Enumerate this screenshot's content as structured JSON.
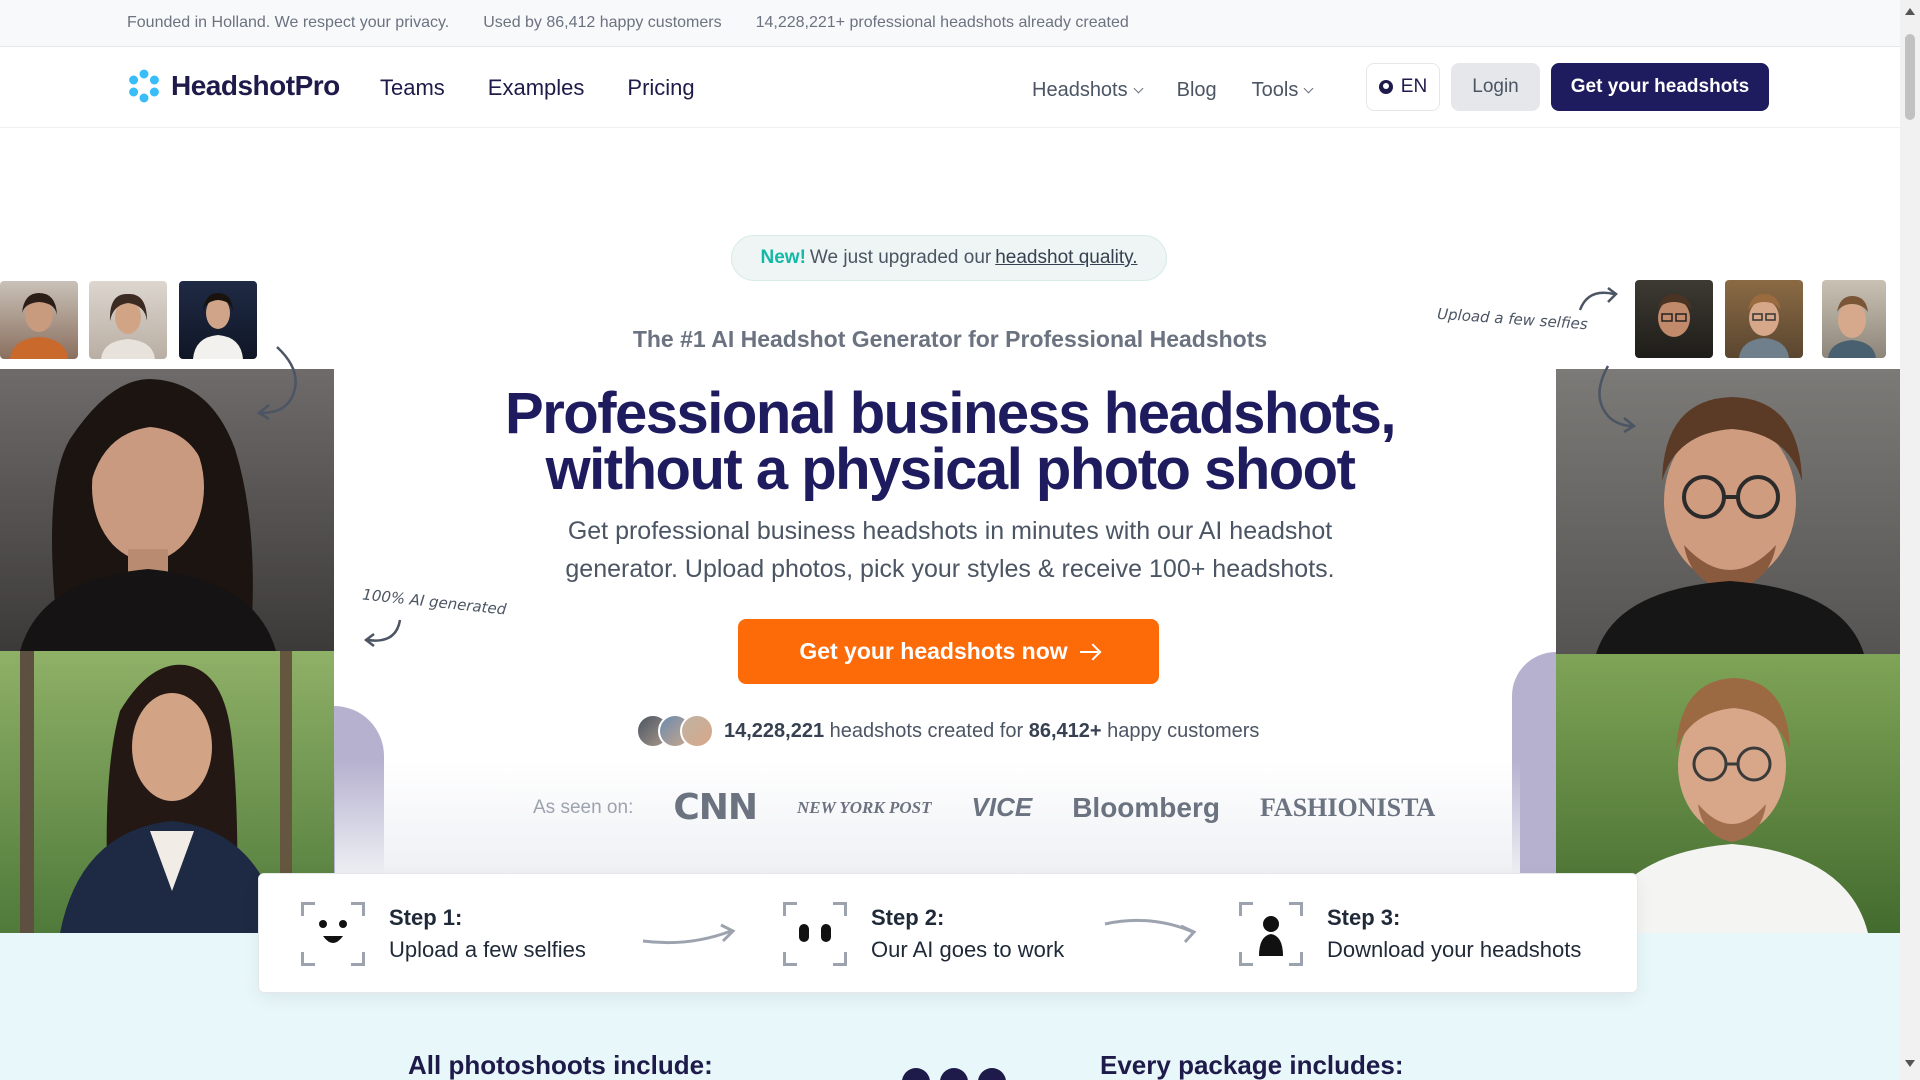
{
  "topbar": {
    "items": [
      "Founded in Holland. We respect your privacy.",
      "Used by 86,412 happy customers",
      "14,228,221+ professional headshots already created"
    ]
  },
  "nav": {
    "logo_text": "HeadshotPro",
    "left": [
      "Teams",
      "Examples",
      "Pricing"
    ],
    "right": [
      "Headshots",
      "Blog",
      "Tools"
    ],
    "lang": "EN",
    "login": "Login",
    "cta": "Get your headshots"
  },
  "hero": {
    "badge_new": "New!",
    "badge_text": "We just upgraded our",
    "badge_link": "headshot quality.",
    "subhead": "The #1 AI Headshot Generator for Professional Headshots",
    "title_line1": "Professional business headshots,",
    "title_line2": "without a physical photo shoot",
    "lead_line1": "Get professional business headshots in minutes with our AI headshot",
    "lead_line2": "generator. Upload photos, pick your styles & receive 100+ headshots.",
    "cta": "Get your headshots now",
    "social_count": "14,228,221",
    "social_mid": "headshots created for",
    "social_customers": "86,412+",
    "social_end": "happy customers",
    "seen_label": "As seen on:",
    "brands": [
      "CNN",
      "NEW YORK POST",
      "VICE",
      "Bloomberg",
      "FASHIONISTA"
    ],
    "note_left": "100% AI generated",
    "note_right": "Upload a few selfies"
  },
  "steps": [
    {
      "title": "Step 1:",
      "desc": "Upload a few selfies",
      "icon": "smile-face-icon"
    },
    {
      "title": "Step 2:",
      "desc": "Our AI goes to work",
      "icon": "eyes-scan-icon"
    },
    {
      "title": "Step 3:",
      "desc": "Download your headshots",
      "icon": "person-silhouette-icon"
    }
  ],
  "bottom": {
    "left_heading": "All photoshoots include:",
    "right_heading": "Every package includes:"
  },
  "colors": {
    "brand_navy": "#1e1b5e",
    "cta_orange": "#fd6a08",
    "accent_teal": "#14b8a6",
    "lower_bg": "#e8f7f9"
  }
}
